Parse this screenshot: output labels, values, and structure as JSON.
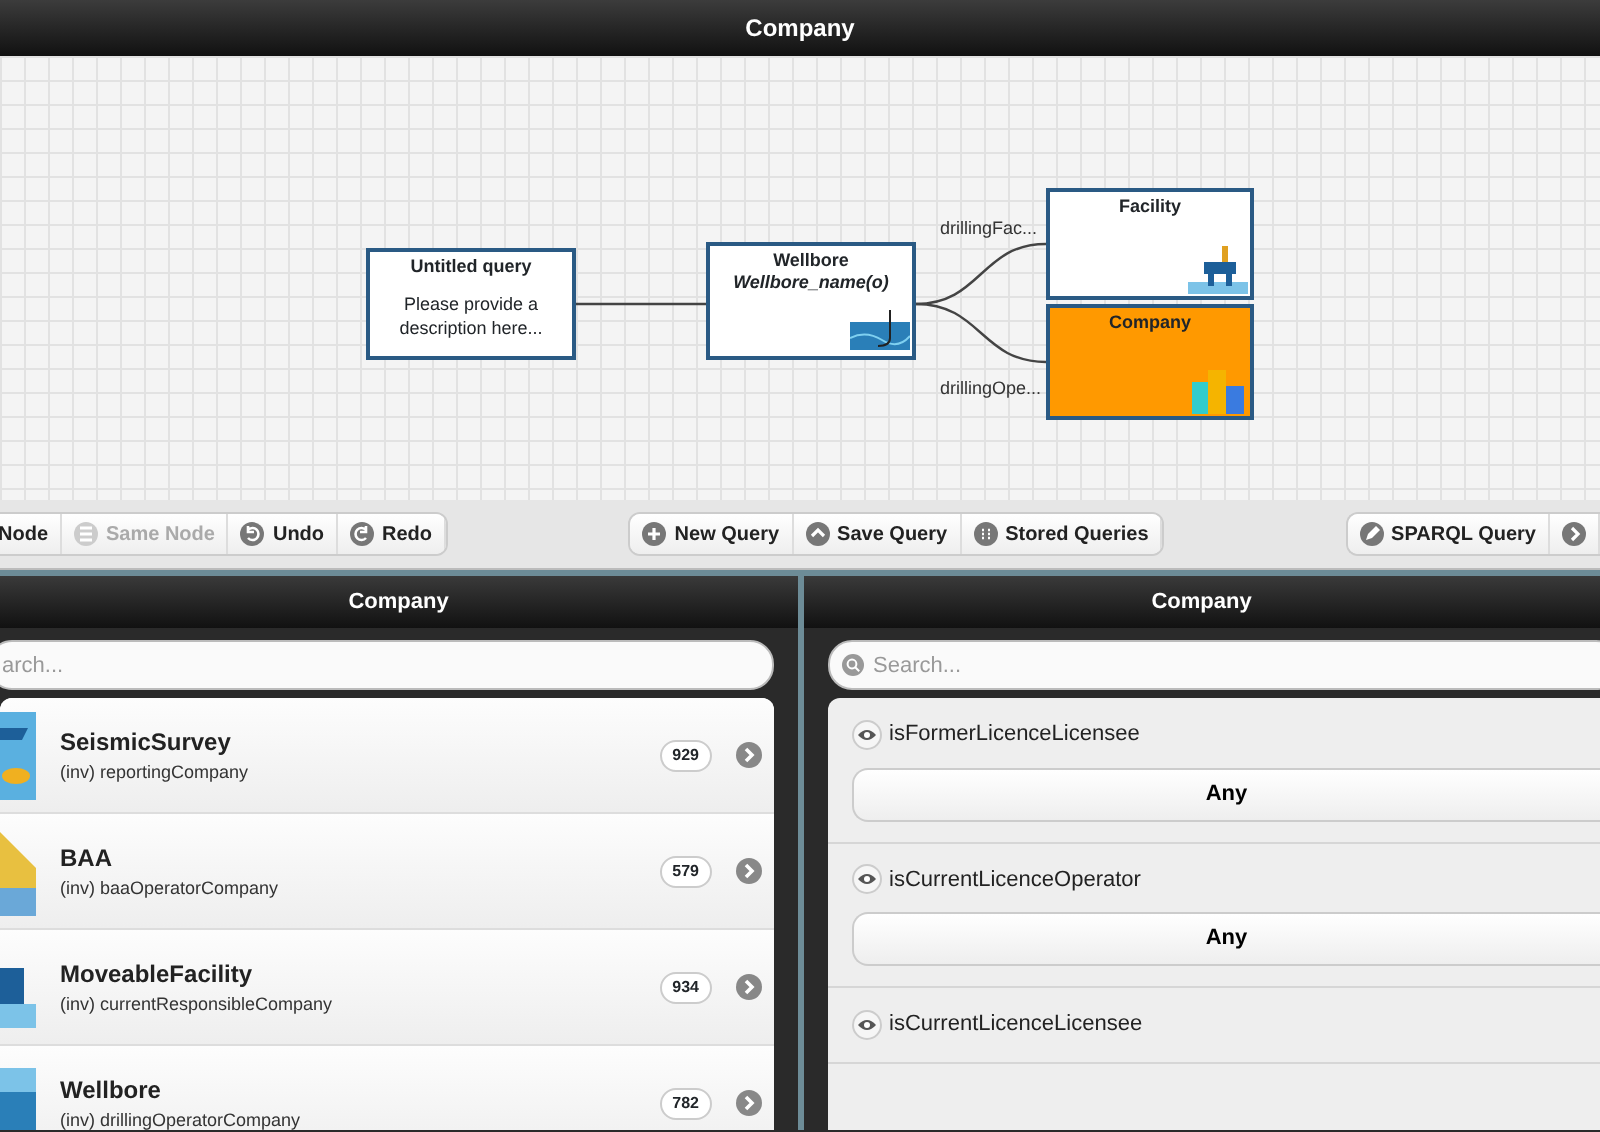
{
  "header": {
    "title": "Company"
  },
  "diagram": {
    "nodes": [
      {
        "kind": "query",
        "title": "Untitled query",
        "description": "Please provide a description here...",
        "selected": false
      },
      {
        "kind": "class",
        "title": "Wellbore",
        "subtitle": "Wellbore_name(o)",
        "selected": false
      },
      {
        "kind": "class",
        "title": "Facility",
        "selected": false
      },
      {
        "kind": "class",
        "title": "Company",
        "selected": true
      }
    ],
    "edges": [
      {
        "label": "drillingFac..."
      },
      {
        "label": "drillingOpe..."
      }
    ]
  },
  "toolbar": [
    [
      {
        "label": "Node",
        "disabled": false
      },
      {
        "label": "Same Node",
        "disabled": true
      },
      {
        "label": "Undo",
        "disabled": false
      },
      {
        "label": "Redo",
        "disabled": false
      }
    ],
    [
      {
        "label": "New Query",
        "disabled": false
      },
      {
        "label": "Save Query",
        "disabled": false
      },
      {
        "label": "Stored Queries",
        "disabled": false
      }
    ],
    [
      {
        "label": "SPARQL Query",
        "disabled": false
      },
      {
        "disabled": false
      }
    ]
  ],
  "left_panel": {
    "title": "Company",
    "search": {
      "placeholder": "arch..."
    },
    "items": [
      {
        "title": "SeismicSurvey",
        "subtitle": "(inv) reportingCompany",
        "count": "929"
      },
      {
        "title": "BAA",
        "subtitle": "(inv) baaOperatorCompany",
        "count": "579"
      },
      {
        "title": "MoveableFacility",
        "subtitle": "(inv) currentResponsibleCompany",
        "count": "934"
      },
      {
        "title": "Wellbore",
        "subtitle": "(inv) drillingOperatorCompany",
        "count": "782"
      }
    ]
  },
  "right_panel": {
    "title": "Company",
    "search": {
      "placeholder": "Search..."
    },
    "properties": [
      {
        "name": "isFormerLicenceLicensee",
        "value": "Any"
      },
      {
        "name": "isCurrentLicenceOperator",
        "value": "Any"
      },
      {
        "name": "isCurrentLicenceLicensee"
      }
    ]
  }
}
